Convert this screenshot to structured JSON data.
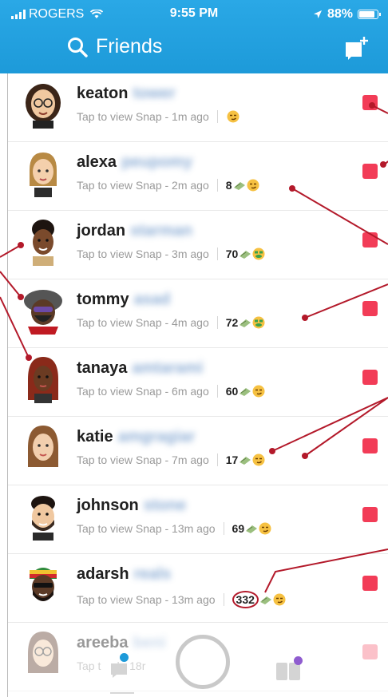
{
  "status_bar": {
    "carrier": "ROGERS",
    "time": "9:55 PM",
    "battery": "88%"
  },
  "header": {
    "title": "Friends",
    "icons": [
      "search-icon",
      "new-chat-icon"
    ]
  },
  "friends": [
    {
      "first": "keaton",
      "last": "tower",
      "status": "Tap to view Snap - 1m ago",
      "streak": "",
      "emoji": "smirk"
    },
    {
      "first": "alexa",
      "last": "peupomy",
      "status": "Tap to view Snap - 2m ago",
      "streak": "8",
      "emoji": "smirk"
    },
    {
      "first": "jordan",
      "last": "starman",
      "status": "Tap to view Snap - 3m ago",
      "streak": "70",
      "emoji": "money-mouth"
    },
    {
      "first": "tommy",
      "last": "asad",
      "status": "Tap to view Snap - 4m ago",
      "streak": "72",
      "emoji": "money-mouth"
    },
    {
      "first": "tanaya",
      "last": "amtarami",
      "status": "Tap to view Snap - 6m ago",
      "streak": "60",
      "emoji": "smirk"
    },
    {
      "first": "katie",
      "last": "amgragiar",
      "status": "Tap to view Snap - 7m ago",
      "streak": "17",
      "emoji": "smirk"
    },
    {
      "first": "johnson",
      "last": "stone",
      "status": "Tap to view Snap - 13m ago",
      "streak": "69",
      "emoji": "smirk"
    },
    {
      "first": "adarsh",
      "last": "reals",
      "status": "Tap to view Snap - 13m ago",
      "streak": "332",
      "emoji": "smirk"
    },
    {
      "first": "areeba",
      "last": "beni",
      "status": "Tap t    d - 18r",
      "streak": "",
      "emoji": ""
    }
  ],
  "colors": {
    "header_blue": "#1d9ad9",
    "snap_red": "#f23c57",
    "annotation_red": "#b3192a",
    "chat_dot": "#1d9ad9",
    "stories_dot": "#8f5ccf"
  },
  "bottom_nav": {
    "icons": [
      "chat-tab-icon",
      "capture-button",
      "stories-tab-icon"
    ]
  }
}
